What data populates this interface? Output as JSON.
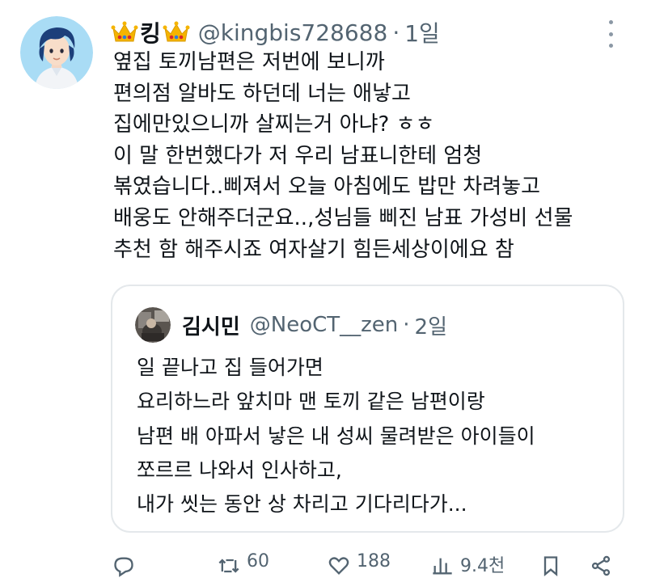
{
  "tweet": {
    "display_name": "킹",
    "handle": "@kingbis728688",
    "separator": "·",
    "time": "1일",
    "avatar_icon": "profile-avatar",
    "crown_icon": "crown-emoji",
    "lines": [
      "옆집 토끼남편은 저번에 보니까",
      "편의점 알바도 하던데 너는 애낳고",
      "집에만있으니까 살찌는거 아냐? ㅎㅎ",
      "이 말 한번했다가 저 우리 남표니한테 엄청",
      "볶였습니다..삐져서 오늘 아침에도 밥만 차려놓고",
      "배웅도 안해주더군요..,성님들 삐진 남표 가성비 선물",
      "추천 함 해주시죠 여자살기 힘든세상이에요 참"
    ]
  },
  "quoted": {
    "display_name": "김시민",
    "handle": "@NeoCT__zen",
    "separator": "·",
    "time": "2일",
    "lines": [
      "일 끝나고 집 들어가면",
      "요리하느라 앞치마 맨 토끼 같은 남편이랑",
      "남편 배 아파서 낳은 내 성씨 물려받은 아이들이",
      "쪼르르 나와서 인사하고,",
      "내가 씻는 동안 상 차리고 기다리다가..."
    ]
  },
  "actions": {
    "reply_icon": "reply-icon",
    "retweet_icon": "retweet-icon",
    "retweet_count": "60",
    "like_icon": "heart-icon",
    "like_count": "188",
    "views_icon": "views-icon",
    "views_count": "9.4천",
    "bookmark_icon": "bookmark-icon",
    "share_icon": "share-icon"
  },
  "colors": {
    "text": "#0f1419",
    "secondary": "#536471",
    "border": "#e4e8eb",
    "crown_gold": "#f5b400",
    "crown_red": "#d8262e",
    "avatar_bg": "#9fd6f2"
  }
}
